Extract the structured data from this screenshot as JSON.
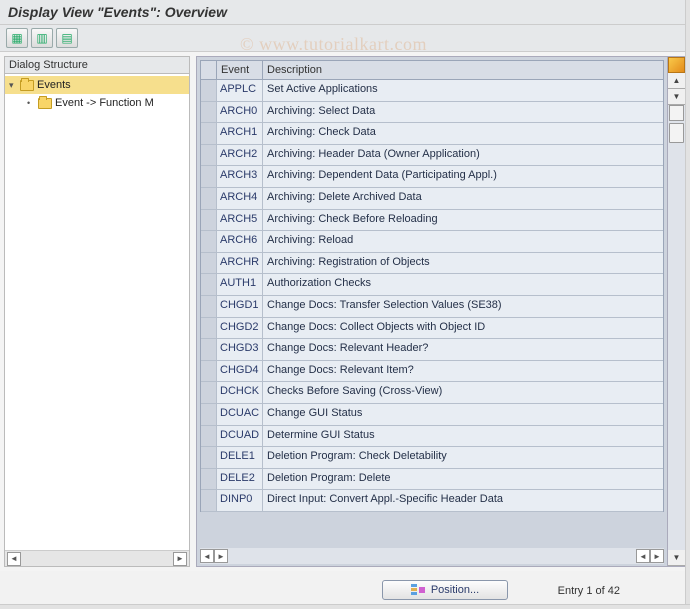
{
  "title": "Display View \"Events\": Overview",
  "watermark": "© www.tutorialkart.com",
  "toolbar": {
    "btn1_name": "table-icon-1",
    "btn2_name": "table-icon-2",
    "btn3_name": "table-icon-3"
  },
  "sidebar": {
    "heading": "Dialog Structure",
    "items": [
      {
        "label": "Events",
        "expanded": true,
        "selected": true,
        "indent": 0
      },
      {
        "label": "Event -> Function M",
        "expanded": false,
        "selected": false,
        "indent": 1
      }
    ]
  },
  "table": {
    "headers": {
      "event": "Event",
      "description": "Description"
    },
    "rows": [
      {
        "event": "APPLC",
        "desc": "Set Active Applications"
      },
      {
        "event": "ARCH0",
        "desc": "Archiving: Select Data"
      },
      {
        "event": "ARCH1",
        "desc": "Archiving: Check Data"
      },
      {
        "event": "ARCH2",
        "desc": "Archiving: Header Data (Owner Application)"
      },
      {
        "event": "ARCH3",
        "desc": "Archiving: Dependent Data (Participating Appl.)"
      },
      {
        "event": "ARCH4",
        "desc": "Archiving: Delete Archived Data"
      },
      {
        "event": "ARCH5",
        "desc": "Archiving: Check Before Reloading"
      },
      {
        "event": "ARCH6",
        "desc": "Archiving: Reload"
      },
      {
        "event": "ARCHR",
        "desc": "Archiving: Registration of Objects"
      },
      {
        "event": "AUTH1",
        "desc": "Authorization Checks"
      },
      {
        "event": "CHGD1",
        "desc": "Change Docs: Transfer Selection Values (SE38)"
      },
      {
        "event": "CHGD2",
        "desc": "Change Docs: Collect Objects with Object ID"
      },
      {
        "event": "CHGD3",
        "desc": "Change Docs: Relevant Header?"
      },
      {
        "event": "CHGD4",
        "desc": "Change Docs: Relevant Item?"
      },
      {
        "event": "DCHCK",
        "desc": "Checks Before Saving (Cross-View)"
      },
      {
        "event": "DCUAC",
        "desc": "Change GUI Status"
      },
      {
        "event": "DCUAD",
        "desc": "Determine GUI Status"
      },
      {
        "event": "DELE1",
        "desc": "Deletion Program: Check Deletability"
      },
      {
        "event": "DELE2",
        "desc": "Deletion Program: Delete"
      },
      {
        "event": "DINP0",
        "desc": "Direct Input: Convert Appl.-Specific Header Data"
      }
    ]
  },
  "footer": {
    "position_label": "Position...",
    "entry_text": "Entry 1 of 42"
  }
}
